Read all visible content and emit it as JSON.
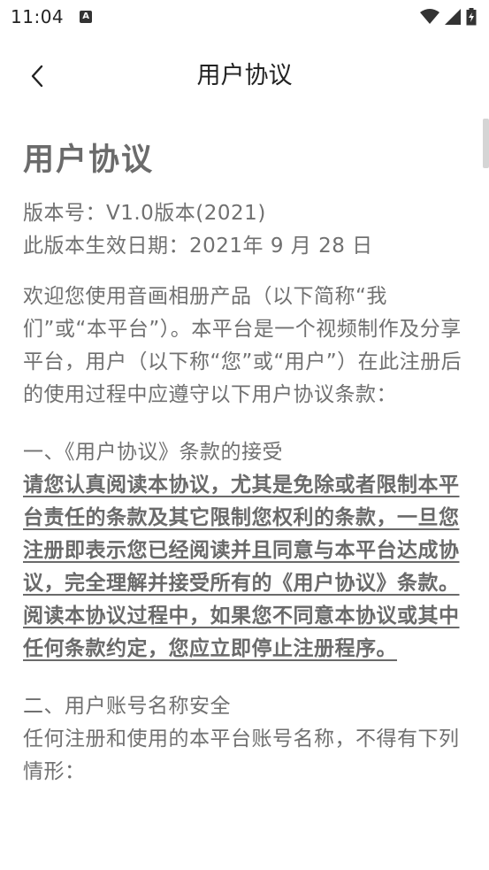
{
  "status_bar": {
    "time": "11:04",
    "notification_icon": "a-icon",
    "icons": [
      "wifi-icon",
      "signal-icon",
      "battery-icon"
    ]
  },
  "nav": {
    "back_icon": "chevron-left-icon",
    "title": "用户协议"
  },
  "document": {
    "title": "用户协议",
    "version": "版本号：V1.0版本(2021)",
    "effective_date": "此版本生效日期：2021年 9 月 28 日",
    "intro": "欢迎您使用音画相册产品（以下简称“我们”或“本平台”）。本平台是一个视频制作及分享平台，用户（以下称“您”或“用户”）在此注册后的使用过程中应遵守以下用户协议条款：",
    "section1_heading": "一、《用户协议》条款的接受",
    "section1_body": "请您认真阅读本协议，尤其是免除或者限制本平台责任的条款及其它限制您权利的条款，一旦您注册即表示您已经阅读并且同意与本平台达成协议，完全理解并接受所有的《用户协议》条款。阅读本协议过程中，如果您不同意本协议或其中任何条款约定，您应立即停止注册程序。",
    "section2_heading": "二、用户账号名称安全",
    "section2_body": "任何注册和使用的本平台账号名称，不得有下列情形："
  }
}
